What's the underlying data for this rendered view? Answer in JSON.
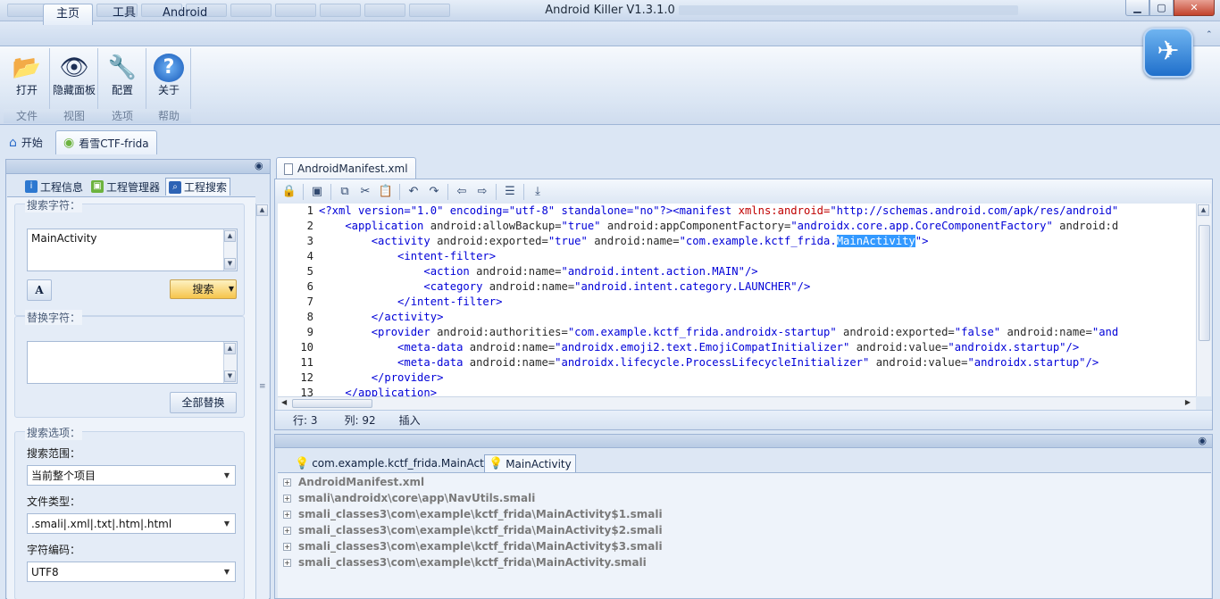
{
  "window": {
    "title": "Android Killer V1.3.1.0",
    "controls": {
      "minimize": "▁",
      "maximize": "▢",
      "close": "✕"
    }
  },
  "ribbon": {
    "tabs": [
      "主页",
      "工具",
      "Android"
    ],
    "buttons": [
      {
        "label": "打开",
        "icon": "folder-open-icon"
      },
      {
        "label": "隐藏面板",
        "icon": "eye-icon"
      },
      {
        "label": "配置",
        "icon": "tools-icon"
      },
      {
        "label": "关于",
        "icon": "help-icon"
      }
    ],
    "groups": [
      "文件",
      "视图",
      "选项",
      "帮助"
    ]
  },
  "doc_tabs": [
    {
      "label": "开始",
      "icon": "home-icon"
    },
    {
      "label": "看雪CTF-frida",
      "icon": "android-icon"
    }
  ],
  "left_panel": {
    "tabs": [
      "工程信息",
      "工程管理器",
      "工程搜索"
    ],
    "search": {
      "group_label": "搜索字符：",
      "value": "MainActivity",
      "search_button": "搜索"
    },
    "replace": {
      "group_label": "替换字符：",
      "value": "",
      "replace_all_button": "全部替换"
    },
    "options": {
      "group_label": "搜索选项：",
      "scope_label": "搜索范围：",
      "scope_value": "当前整个项目",
      "filetype_label": "文件类型：",
      "filetype_value": ".smali|.xml|.txt|.htm|.html",
      "encoding_label": "字符编码：",
      "encoding_value": "UTF8"
    }
  },
  "editor": {
    "tab_label": "AndroidManifest.xml",
    "lines": [
      {
        "n": "1",
        "parts": [
          [
            "<?xml version=\"1.0\" encoding=\"utf-8\" standalone=\"no\"?>",
            "bl"
          ],
          [
            "<manifest ",
            "bl"
          ],
          [
            "xmlns:android=",
            "rd"
          ],
          [
            "\"http://schemas.android.com/apk/res/android\"",
            "vl"
          ]
        ]
      },
      {
        "n": "2",
        "parts": [
          [
            "    <application ",
            "bl"
          ],
          [
            "android:allowBackup=",
            "at"
          ],
          [
            "\"true\" ",
            "vl"
          ],
          [
            "android:appComponentFactory=",
            "at"
          ],
          [
            "\"androidx.core.app.CoreComponentFactory\" ",
            "vl"
          ],
          [
            "android:d",
            "at"
          ]
        ]
      },
      {
        "n": "3",
        "parts": [
          [
            "        <activity ",
            "bl"
          ],
          [
            "android:exported=",
            "at"
          ],
          [
            "\"true\" ",
            "vl"
          ],
          [
            "android:name=",
            "at"
          ],
          [
            "\"com.example.kctf_frida.",
            "vl"
          ],
          [
            "MainActivity",
            "hl"
          ],
          [
            "\">",
            "vl"
          ]
        ]
      },
      {
        "n": "4",
        "parts": [
          [
            "            <intent-filter>",
            "bl"
          ]
        ]
      },
      {
        "n": "5",
        "parts": [
          [
            "                <action ",
            "bl"
          ],
          [
            "android:name=",
            "at"
          ],
          [
            "\"android.intent.action.MAIN\"",
            "vl"
          ],
          [
            "/>",
            "bl"
          ]
        ]
      },
      {
        "n": "6",
        "parts": [
          [
            "                <category ",
            "bl"
          ],
          [
            "android:name=",
            "at"
          ],
          [
            "\"android.intent.category.LAUNCHER\"",
            "vl"
          ],
          [
            "/>",
            "bl"
          ]
        ]
      },
      {
        "n": "7",
        "parts": [
          [
            "            </intent-filter>",
            "bl"
          ]
        ]
      },
      {
        "n": "8",
        "parts": [
          [
            "        </activity>",
            "bl"
          ]
        ]
      },
      {
        "n": "9",
        "parts": [
          [
            "        <provider ",
            "bl"
          ],
          [
            "android:authorities=",
            "at"
          ],
          [
            "\"com.example.kctf_frida.androidx-startup\" ",
            "vl"
          ],
          [
            "android:exported=",
            "at"
          ],
          [
            "\"false\" ",
            "vl"
          ],
          [
            "android:name=",
            "at"
          ],
          [
            "\"and",
            "vl"
          ]
        ]
      },
      {
        "n": "10",
        "parts": [
          [
            "            <meta-data ",
            "bl"
          ],
          [
            "android:name=",
            "at"
          ],
          [
            "\"androidx.emoji2.text.EmojiCompatInitializer\" ",
            "vl"
          ],
          [
            "android:value=",
            "at"
          ],
          [
            "\"androidx.startup\"",
            "vl"
          ],
          [
            "/>",
            "bl"
          ]
        ]
      },
      {
        "n": "11",
        "parts": [
          [
            "            <meta-data ",
            "bl"
          ],
          [
            "android:name=",
            "at"
          ],
          [
            "\"androidx.lifecycle.ProcessLifecycleInitializer\" ",
            "vl"
          ],
          [
            "android:value=",
            "at"
          ],
          [
            "\"androidx.startup\"",
            "vl"
          ],
          [
            "/>",
            "bl"
          ]
        ]
      },
      {
        "n": "12",
        "parts": [
          [
            "        </provider>",
            "bl"
          ]
        ]
      },
      {
        "n": "13",
        "parts": [
          [
            "    </application>",
            "bl"
          ]
        ]
      }
    ],
    "status": {
      "row_label": "行: 3",
      "col_label": "列: 92",
      "mode": "插入"
    }
  },
  "results": {
    "tabs": [
      "com.example.kctf_frida.MainAct...",
      "MainActivity"
    ],
    "items": [
      "AndroidManifest.xml",
      "smali\\androidx\\core\\app\\NavUtils.smali",
      "smali_classes3\\com\\example\\kctf_frida\\MainActivity$1.smali",
      "smali_classes3\\com\\example\\kctf_frida\\MainActivity$2.smali",
      "smali_classes3\\com\\example\\kctf_frida\\MainActivity$3.smali",
      "smali_classes3\\com\\example\\kctf_frida\\MainActivity.smali"
    ]
  }
}
